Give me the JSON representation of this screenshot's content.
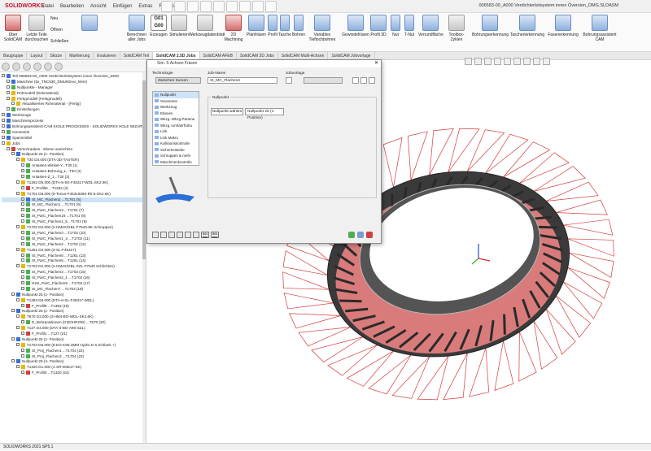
{
  "app": {
    "logo": "SOLIDWORKS",
    "menu": [
      "Datei",
      "Bearbeiten",
      "Ansicht",
      "Einfügen",
      "Extras",
      "Fenster"
    ],
    "window_title": "006583-00_A000 Verdichterleitsystem innen Översion_DMG.SLDASM",
    "status": "SOLIDWORKS 2021 SP5.1"
  },
  "ribbon": {
    "ueber": "Über\nSolidCAM",
    "letzte": "Letzte Teile\ndurchsuchen",
    "neu": "Neu",
    "oeffnen": "Öffnen",
    "schliessen": "Schließen",
    "berechnen": "Berechnen\naller Jobs",
    "g01": "G01\nG00",
    "erzeugen": "Erzeugen",
    "simulieren": "Simulieren",
    "werkzeug": "Werkzeugdatenblatt",
    "twoD": "2D\nMachining",
    "planfraesen": "Planfräsen",
    "profil": "Profil",
    "tasche": "Tasche",
    "bohren": "Bohren",
    "variables": "Variables\nTieflochbohren",
    "gewinde": "Gewindefräsen",
    "profil3d": "Profil 3D",
    "nut": "Nut",
    "tnut": "T-Nut",
    "verrund": "Verrundfläche",
    "toolbox": "Toolbox-Zyklen",
    "bohrungserk": "Bohrungserkennung",
    "taschenerk": "Taschenerkennung",
    "fasenerk": "Fasenerkennung",
    "bohrassist": "Bohrungsassistent\nCAM"
  },
  "tabs": [
    "Baugruppe",
    "Layout",
    "Skizze",
    "Markierung",
    "Evaluieren",
    "SolidCAM Teil",
    "SolidCAM 2.5D Jobs",
    "SolidCAM AFEB",
    "SolidCAM 3D Jobs",
    "SolidCAM Multi-Achsen",
    "SolidCAM Jobvorlage"
  ],
  "active_tab": "SolidCAM 2.5D Jobs",
  "tree": [
    {
      "t": "Teil 006583-00_A000 Verdichterleitsystem innen Översion_DMG",
      "d": 1,
      "i": "b"
    },
    {
      "t": "Maschine (5x_TNC530_DMU60evo_klein)",
      "d": 2,
      "i": "b"
    },
    {
      "t": "Nullpunkte - Manager",
      "d": 2,
      "i": "g"
    },
    {
      "t": "Rohmodell (Rohmaterial)",
      "d": 2,
      "i": "y"
    },
    {
      "t": "Fertigmodell (Fertigmodell)",
      "d": 2,
      "i": "y"
    },
    {
      "t": "Aktualisiertes Rohmaterial - [Fertig]",
      "d": 3,
      "i": "y"
    },
    {
      "t": "Einstellungen",
      "d": 2,
      "i": "g"
    },
    {
      "t": "Werkzeuge",
      "d": 1,
      "i": "b"
    },
    {
      "t": "Maschinenprozess",
      "d": 1,
      "i": "b"
    },
    {
      "t": "Bohrungsassistent CAM (HOLE PROCESSES - SOLIDWORKS HOLE WIZARD - METRI",
      "d": 1,
      "i": "b"
    },
    {
      "t": "Geometrie",
      "d": 1,
      "i": "g"
    },
    {
      "t": "Spannmittel",
      "d": 1,
      "i": "b"
    },
    {
      "t": "Jobs",
      "d": 1,
      "i": "y"
    },
    {
      "t": "Verschrauben - Ebene ausrichten",
      "d": 2,
      "i": "r"
    },
    {
      "t": "Nullpunkt 25 (1- Position)",
      "d": 3,
      "i": "b"
    },
    {
      "t": "T30 D4.000 (DTA-3D-TASTER)",
      "d": 4,
      "i": "y"
    },
    {
      "t": "Antasten-Winkel-Y...T30 (1)",
      "d": 5,
      "i": "g"
    },
    {
      "t": "Antasten-Bohrung_L...T30 (2)",
      "d": 5,
      "i": "g"
    },
    {
      "t": "Antasten-Z_1...T30 (3)",
      "d": 5,
      "i": "g"
    },
    {
      "t": "T1262 D5.000 (DTA-5-SK-F45317-WDL-SK2.6K)",
      "d": 4,
      "i": "y"
    },
    {
      "t": "F_Profil5I ...T1262 (4)",
      "d": 5,
      "i": "r"
    },
    {
      "t": "T1701 D8.000 (5-Tonus-F45318260-R0.5-SK2.6K)",
      "d": 4,
      "i": "y"
    },
    {
      "t": "St_MC_Flachen2 ...T1701 (5)",
      "d": 5,
      "i": "b",
      "hl": true
    },
    {
      "t": "St_MC_Flachen1 ...T1701 (6)",
      "d": 5,
      "i": "g"
    },
    {
      "t": "St_ParC_Flachen3 ...T1701 (7)",
      "d": 5,
      "i": "g"
    },
    {
      "t": "St_ParC_Flachen16 ...T1701 (8)",
      "d": 5,
      "i": "g"
    },
    {
      "t": "St_ParC_Flachen1_5...T1701 (9)",
      "d": 5,
      "i": "g"
    },
    {
      "t": "T1702 D2.000 (2-HM4X/GBL-F7540-8K Schruppen)",
      "d": 4,
      "i": "y"
    },
    {
      "t": "St_ParC_Flachen3 ...T1702 (10)",
      "d": 5,
      "i": "g"
    },
    {
      "t": "St_ParC_Flachen1_3 ...T1702 (11)",
      "d": 5,
      "i": "g"
    },
    {
      "t": "St_ParC_Flachen2 ...T1702 (12)",
      "d": 5,
      "i": "g"
    },
    {
      "t": "T1261 D3.000 (3-SL-F45317)",
      "d": 4,
      "i": "y"
    },
    {
      "t": "St_ParC_Flachen6 ...T1261 (13)",
      "d": 5,
      "i": "g"
    },
    {
      "t": "St_ParC_Flachen5 ...T1261 (14)",
      "d": 5,
      "i": "g"
    },
    {
      "t": "T1703 D2.000 (2-HM4X/GBL-SZL-F7540 Schlichten)",
      "d": 4,
      "i": "y"
    },
    {
      "t": "St_ParC_Flachen3 ...T1703 (15)",
      "d": 5,
      "i": "g"
    },
    {
      "t": "St_ParC_Flachen2_1 ...T1703 (16)",
      "d": 5,
      "i": "g"
    },
    {
      "t": "HSS_ParC_Flachen9 ...T1703 (17)",
      "d": 5,
      "i": "g"
    },
    {
      "t": "St_MC_Flachen7 ...T1703 (18)",
      "d": 5,
      "i": "g"
    },
    {
      "t": "Nullpunkt 25 (1- Position)",
      "d": 3,
      "i": "b"
    },
    {
      "t": "T1393 D6.000 (DTA-6-SL-F45317-WDL)",
      "d": 4,
      "i": "y"
    },
    {
      "t": "F_Profil5 ...T1393 (19)",
      "d": 5,
      "i": "r"
    },
    {
      "t": "Nullpunkt 25 (1- Position)",
      "d": 3,
      "i": "b"
    },
    {
      "t": "T670 D3.000 (3-HM4-BO-WDL-SK2.6K)",
      "d": 4,
      "i": "y"
    },
    {
      "t": "D_Bohrpositionen (0 BOHR200) ...T670 (20)",
      "d": 5,
      "i": "g"
    },
    {
      "t": "T127 D4.000 (DTA-4-BG-A90-SZL)",
      "d": 4,
      "i": "y"
    },
    {
      "t": "F_Profil1 ...T127 (21)",
      "d": 5,
      "i": "r"
    },
    {
      "t": "Nullpunkt 25 (1- Position)",
      "d": 3,
      "i": "b"
    },
    {
      "t": "T1704 D6.000 (6-EG-K90-2MM   Hydro D 6 Schlank +)",
      "d": 4,
      "i": "y"
    },
    {
      "t": "St_Proj_Flachen1 ...T1704 (22)",
      "d": 5,
      "i": "g"
    },
    {
      "t": "St_Proj_Flachen3 ...T1704 (23)",
      "d": 5,
      "i": "g"
    },
    {
      "t": "Nullpunkt 25 (4- Position)",
      "d": 3,
      "i": "b"
    },
    {
      "t": "T1320 D1.000 (1-SR-M4517-SK)",
      "d": 4,
      "i": "y"
    },
    {
      "t": "F_Profil3 ...T1320 (24)",
      "d": 5,
      "i": "r"
    }
  ],
  "dialog": {
    "title": "Sim. 5-Achsen Fräsen",
    "close": "✕",
    "technologie_label": "Technologie",
    "technologie_value": "Zwischen Kurven",
    "jobname_label": "Job-Name",
    "jobname_value": "St_MC_Flachen2",
    "jobvorlage_label": "Jobvorlage",
    "nav": [
      "Nullpunkt",
      "Geometrie",
      "Werkzeug",
      "Ebenen",
      "Wkzg.-Wkzg.Parame",
      "Wkzg.-Umfahrfrühu",
      "Link",
      "Link Makro",
      "Kollisionskontrolle",
      "Sicherheitsebe",
      "Schruppen & mehr",
      "Maschinenkontrolle"
    ],
    "nav_selected": 0,
    "group_title": "Nullpunkt",
    "btn_nullpunkt": "Nullpunkt wählen",
    "nullpunkt_value": "Nullpunkt 25 (1- Position)",
    "g01": "G01\nG00"
  }
}
